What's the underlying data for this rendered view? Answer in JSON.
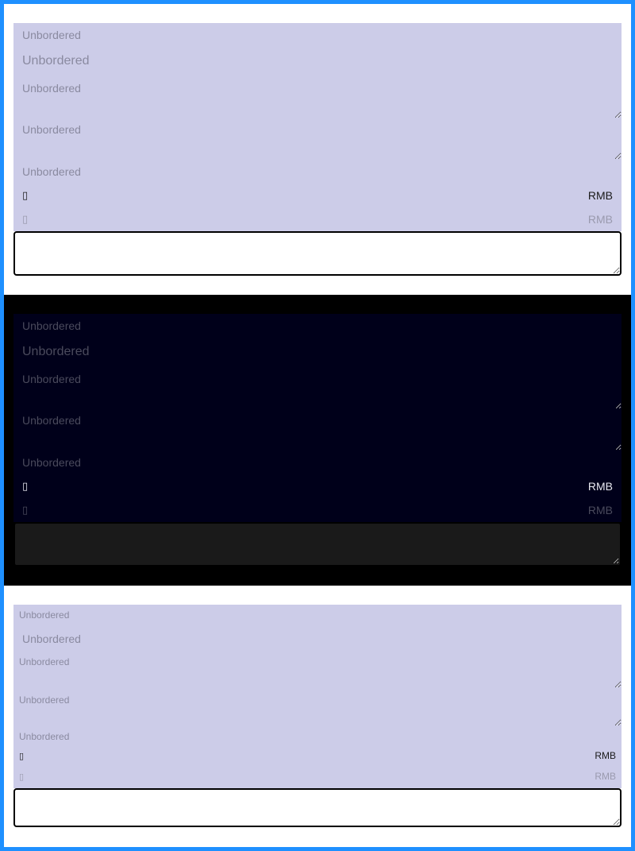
{
  "placeholder": "Unbordered",
  "price": {
    "glyph": "▯",
    "unit": "RMB"
  },
  "theme": {
    "frame_color": "#1e90ff",
    "light_panel": "#cccce8",
    "dark_panel": "#00001a",
    "dark_bg": "#000000"
  }
}
